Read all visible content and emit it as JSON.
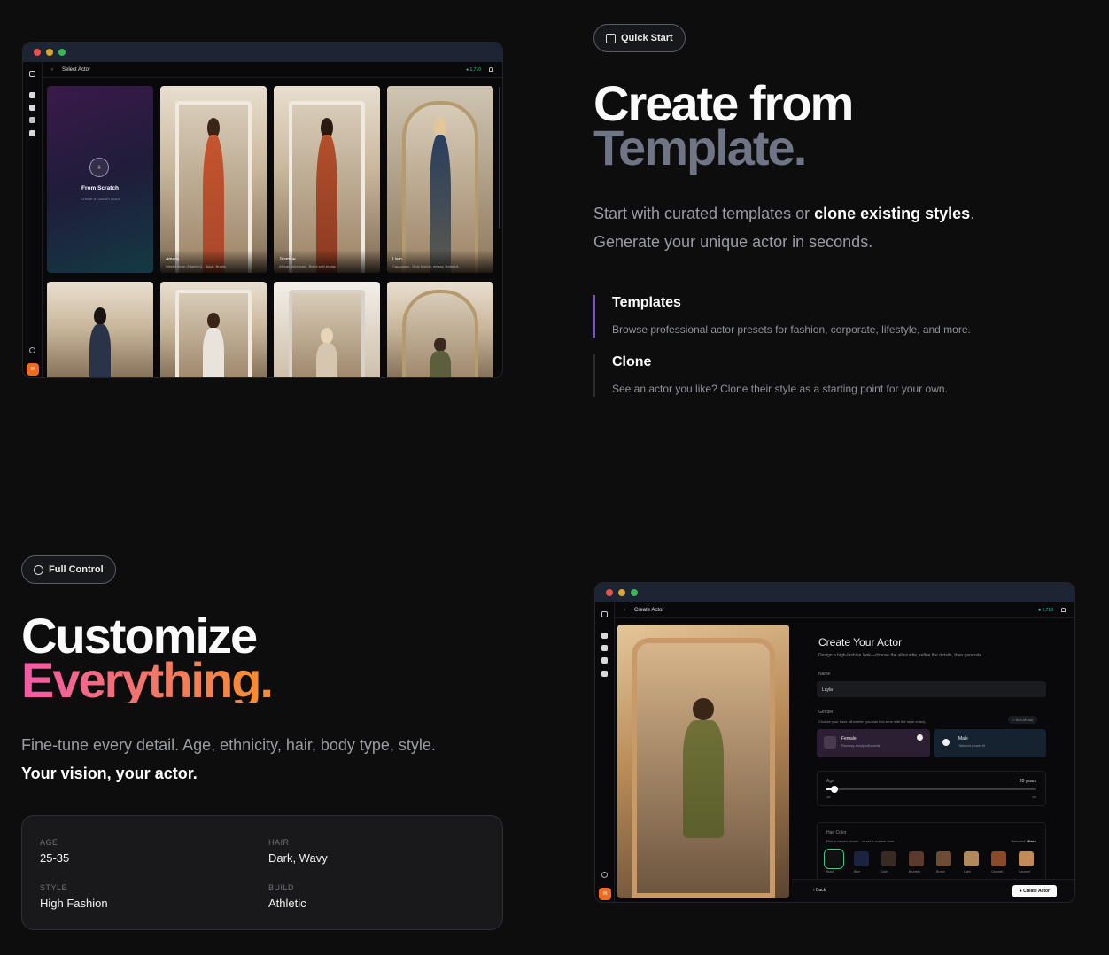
{
  "colors": {
    "accent_purple": "#7b4dd3",
    "accent_orange": "#f26a1b",
    "credit_green": "#3ec98a",
    "gradient_pink": "#f25aa8",
    "gradient_orange": "#f58f2b"
  },
  "template_section": {
    "badge_label": "Quick Start",
    "badge_icon": "copy-icon",
    "title_line1": "Create from",
    "title_line2": "Template.",
    "lead_pre": "Start with curated templates or ",
    "lead_bold": "clone existing styles",
    "lead_post": ".",
    "lead_line2": "Generate your unique actor in seconds.",
    "features": [
      {
        "title": "Templates",
        "desc": "Browse professional actor presets for fashion, corporate, lifestyle, and more."
      },
      {
        "title": "Clone",
        "desc": "See an actor you like? Clone their style as a starting point for your own."
      }
    ]
  },
  "select_window": {
    "page_title": "Select Actor",
    "credits": "1,710",
    "scratch_title": "From Scratch",
    "scratch_desc": "Create a custom actor",
    "actors": [
      {
        "name": "Amara",
        "desc": "West African (Nigerian) - Black, Braids"
      },
      {
        "name": "Jasmine",
        "desc": "African American - Black with braids"
      },
      {
        "name": "Liam",
        "desc": "Caucasian - Dirty blonde, messy, textured"
      }
    ],
    "brand_initial": "m"
  },
  "customize_section": {
    "badge_label": "Full Control",
    "badge_icon": "palette-icon",
    "title_line1": "Customize",
    "title_line2": "Everything.",
    "lead_line1": "Fine-tune every detail. Age, ethnicity, hair, body type, style.",
    "lead_line2": "Your vision, your actor.",
    "stats": [
      {
        "key": "AGE",
        "value": "25-35"
      },
      {
        "key": "HAIR",
        "value": "Dark, Wavy"
      },
      {
        "key": "STYLE",
        "value": "High Fashion"
      },
      {
        "key": "BUILD",
        "value": "Athletic"
      }
    ]
  },
  "create_window": {
    "page_title": "Create Actor",
    "credits": "1,710",
    "form_title": "Create Your Actor",
    "form_sub": "Design a high-fashion look—choose the silhouette, refine the details, then generate.",
    "name_label": "Name",
    "name_value": "Layla",
    "gender_label": "Gender",
    "gender_sub": "Choose your base silhouette (you can fine-tune with the style notes).",
    "nonbinary": "Non-binary",
    "female_title": "Female",
    "female_sub": "Runway-ready silhouette",
    "male_title": "Male",
    "male_sub": "Tailored power fit",
    "age_label": "Age",
    "age_value": "20 years",
    "age_min": "18",
    "age_max": "60",
    "age_fraction": 0.04,
    "hair_label": "Hair Color",
    "hair_sub": "Pick a classic shade—or set a custom tone.",
    "hair_selected_label": "Selected:",
    "hair_selected": "Black",
    "swatches": [
      {
        "name": "Black",
        "color": "#111111"
      },
      {
        "name": "Blue",
        "color": "#1c2340"
      },
      {
        "name": "Dark",
        "color": "#3a2a24"
      },
      {
        "name": "Brunette",
        "color": "#5a3a2a"
      },
      {
        "name": "Brown",
        "color": "#6e4c34"
      },
      {
        "name": "Light",
        "color": "#b08a5c"
      },
      {
        "name": "Caramel",
        "color": "#8a4a2a"
      },
      {
        "name": "Caramel",
        "color": "#c08a5a"
      }
    ],
    "back_label": "Back",
    "create_label": "Create Actor",
    "brand_initial": "m"
  }
}
